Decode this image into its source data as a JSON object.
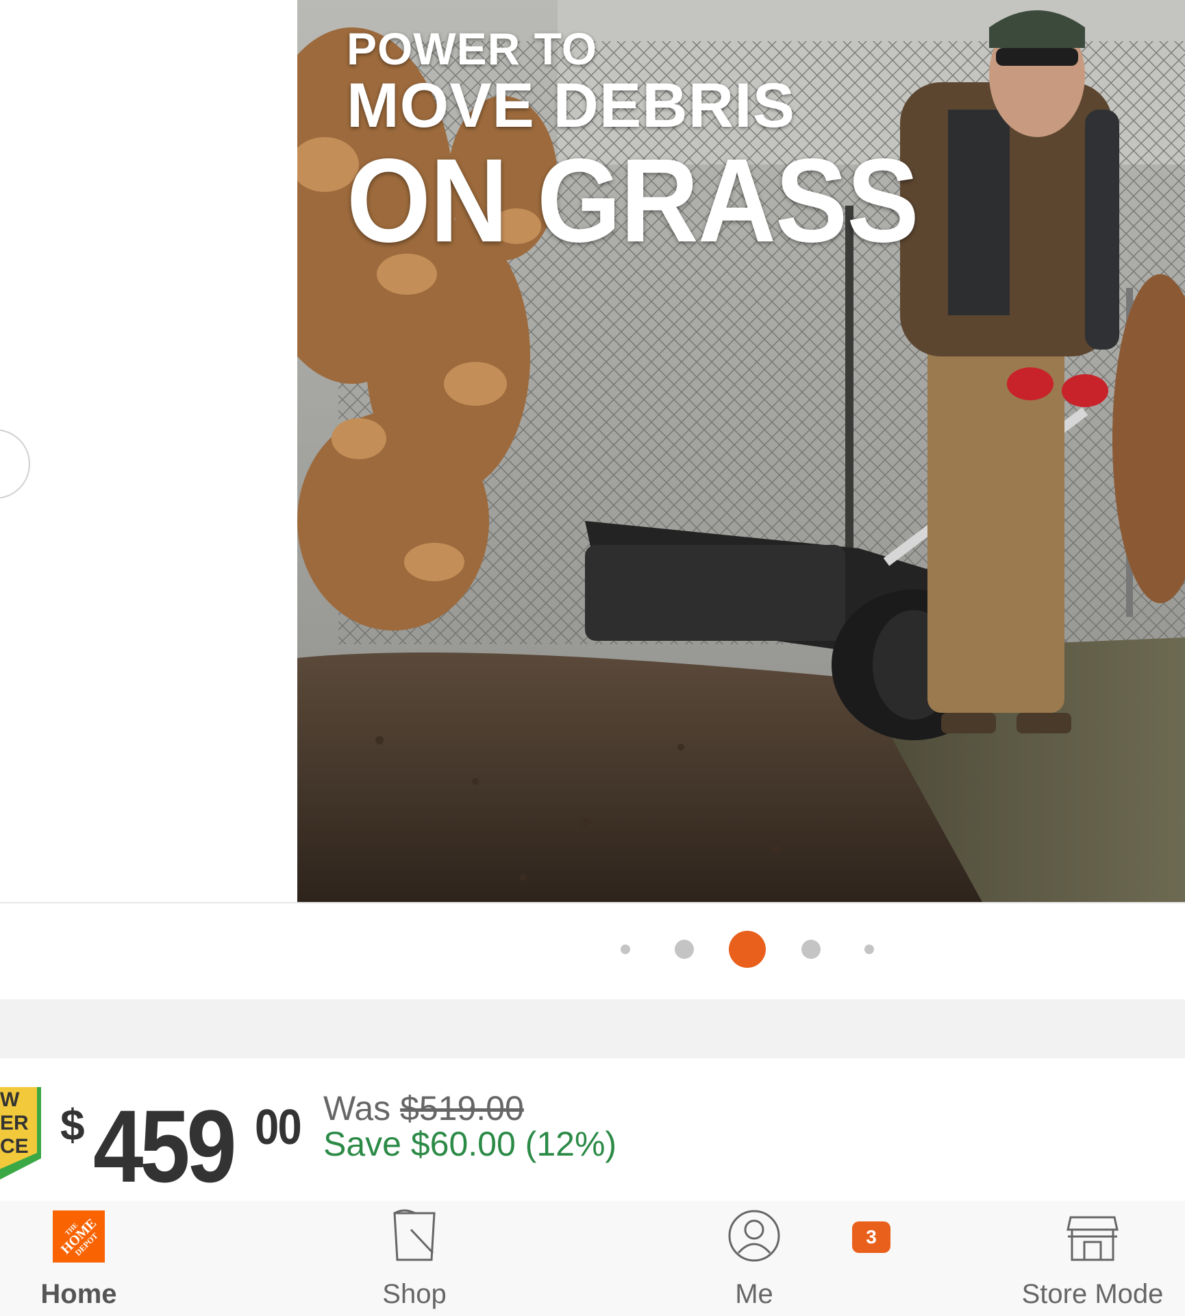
{
  "carousel": {
    "headline": {
      "line1": "POWER TO",
      "line2": "MOVE DEBRIS",
      "line3": "ON GRASS"
    },
    "prev_icon": "chevron-left-icon",
    "dot_count": 5,
    "active_dot_index": 2,
    "accent_color": "#e8601c"
  },
  "pricing": {
    "badge_lines": [
      "W",
      "ER",
      "CE"
    ],
    "currency": "$",
    "dollars": "459",
    "cents": "00",
    "was_label": "Was",
    "was_price": "$519.00",
    "savings": "Save $60.00 (12%)",
    "savings_color": "#2c8a47"
  },
  "bottom_nav": {
    "items": [
      {
        "label": "Home",
        "icon": "home-depot-logo-icon",
        "active": true
      },
      {
        "label": "Shop",
        "icon": "shop-bucket-icon",
        "active": false
      },
      {
        "label": "Me",
        "icon": "user-icon",
        "active": false
      },
      {
        "label": "Store Mode",
        "icon": "store-icon",
        "active": false
      }
    ],
    "badge_count": "3"
  }
}
